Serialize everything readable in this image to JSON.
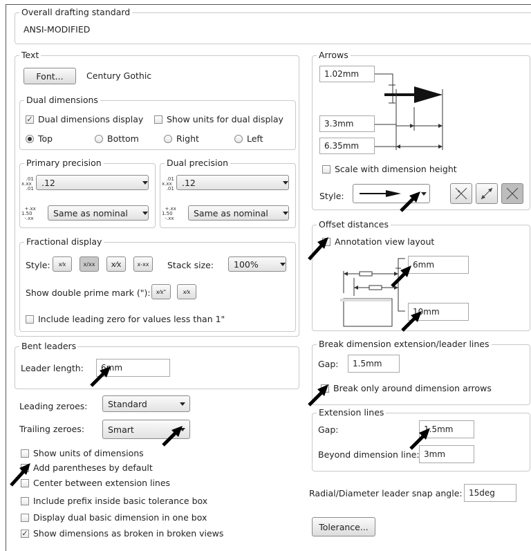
{
  "overall": {
    "title": "Overall drafting standard",
    "value": "ANSI-MODIFIED"
  },
  "text": {
    "title": "Text",
    "font_button": "Font...",
    "font_name": "Century Gothic"
  },
  "dual": {
    "title": "Dual dimensions",
    "display_label": "Dual dimensions display",
    "display_checked": true,
    "units_label": "Show units for dual display",
    "units_checked": false,
    "radios": [
      {
        "label": "Top",
        "selected": true
      },
      {
        "label": "Bottom",
        "selected": false
      },
      {
        "label": "Right",
        "selected": false
      },
      {
        "label": "Left",
        "selected": false
      }
    ]
  },
  "primary_precision": {
    "title": "Primary precision",
    "value": ".12",
    "tolerance": "Same as nominal"
  },
  "dual_precision": {
    "title": "Dual precision",
    "value": ".12",
    "tolerance": "Same as nominal"
  },
  "fractional": {
    "title": "Fractional display",
    "style_label": "Style:",
    "stack_label": "Stack size:",
    "stack_value": "100%",
    "prime_label": "Show double prime mark (\"):",
    "leading_zero_label": "Include leading zero for values less than 1\"",
    "leading_zero_checked": false
  },
  "bent": {
    "title": "Bent leaders",
    "length_label": "Leader length:",
    "length_value": "6mm"
  },
  "zeroes": {
    "leading_label": "Leading zeroes:",
    "leading_value": "Standard",
    "trailing_label": "Trailing zeroes:",
    "trailing_value": "Smart"
  },
  "options": [
    {
      "label": "Show units of dimensions",
      "checked": false
    },
    {
      "label": "Add parentheses by default",
      "checked": false
    },
    {
      "label": "Center between extension lines",
      "checked": false
    },
    {
      "label": "Include prefix inside basic tolerance box",
      "checked": false
    },
    {
      "label": "Display dual basic dimension in one box",
      "checked": false
    },
    {
      "label": "Show dimensions as broken in broken views",
      "checked": true
    }
  ],
  "arrows": {
    "title": "Arrows",
    "size1": "1.02mm",
    "size2": "3.3mm",
    "size3": "6.35mm",
    "scale_label": "Scale with dimension height",
    "scale_checked": false,
    "style_label": "Style:"
  },
  "offset": {
    "title": "Offset distances",
    "layout_label": "Annotation view layout",
    "layout_checked": false,
    "dist1": "6mm",
    "dist2": "10mm"
  },
  "break": {
    "title": "Break dimension extension/leader lines",
    "gap_label": "Gap:",
    "gap_value": "1.5mm",
    "arrows_label": "Break only around dimension arrows",
    "arrows_checked": false
  },
  "extension": {
    "title": "Extension lines",
    "gap_label": "Gap:",
    "gap_value": "1.5mm",
    "beyond_label": "Beyond dimension line:",
    "beyond_value": "3mm"
  },
  "radial": {
    "label": "Radial/Diameter leader snap angle:",
    "value": "15deg"
  },
  "tolerance_button": "Tolerance..."
}
